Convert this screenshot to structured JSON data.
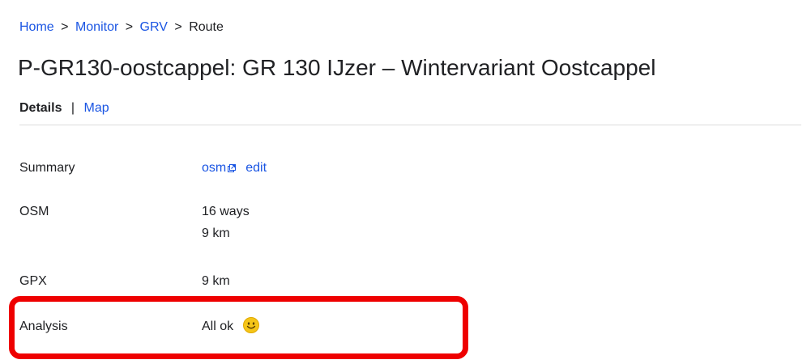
{
  "breadcrumb": {
    "items": [
      "Home",
      "Monitor",
      "GRV"
    ],
    "separator": ">",
    "current": "Route"
  },
  "page": {
    "title": "P-GR130-oostcappel: GR 130 IJzer – Wintervariant Oostcappel"
  },
  "tabs": {
    "details": "Details",
    "separator": "|",
    "map": "Map"
  },
  "details": {
    "summary": {
      "label": "Summary",
      "osm_link": "osm",
      "edit_link": "edit"
    },
    "osm": {
      "label": "OSM",
      "ways": "16 ways",
      "distance": "9 km"
    },
    "gpx": {
      "label": "GPX",
      "distance": "9 km"
    },
    "analysis": {
      "label": "Analysis",
      "value": "All ok",
      "icon": "smiley-face-icon"
    }
  },
  "colors": {
    "link": "#1a55e3",
    "text": "#202124",
    "highlight": "#ee0000",
    "smiley": "#f5c518"
  }
}
